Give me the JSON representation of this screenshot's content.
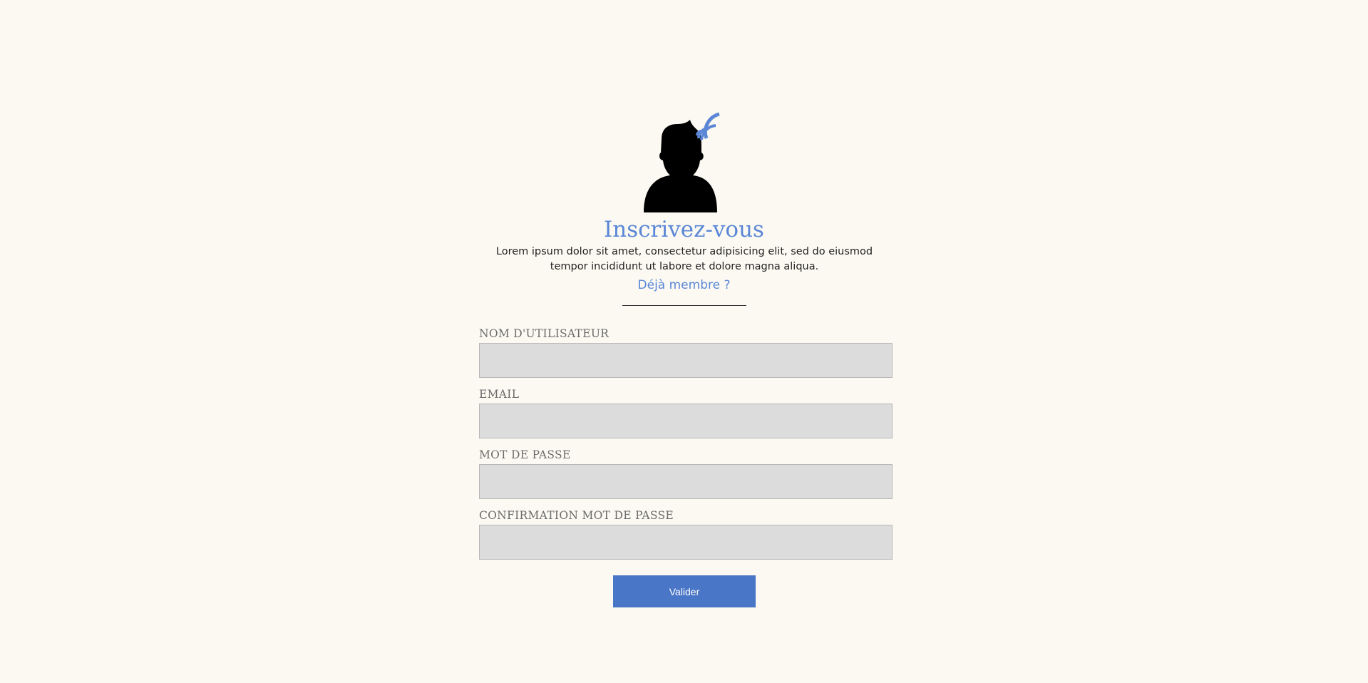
{
  "header": {
    "avatar_icon": "user-wifi-icon",
    "title": "Inscrivez-vous",
    "description": "Lorem ipsum dolor sit amet, consectetur adipisicing elit, sed do eiusmod tempor incididunt ut labore et dolore magna aliqua.",
    "member_link": "Déjà membre ?"
  },
  "form": {
    "fields": [
      {
        "label": "NOM D'UTILISATEUR",
        "value": "",
        "type": "text"
      },
      {
        "label": "EMAIL",
        "value": "",
        "type": "email"
      },
      {
        "label": "MOT DE PASSE",
        "value": "",
        "type": "password"
      },
      {
        "label": "CONFIRMATION MOT DE PASSE",
        "value": "",
        "type": "password"
      }
    ],
    "submit_label": "Valider"
  },
  "colors": {
    "background": "#fbf9f1",
    "accent": "#5b87d6",
    "button": "#4a76c7",
    "input_bg": "#dcdcdc"
  }
}
